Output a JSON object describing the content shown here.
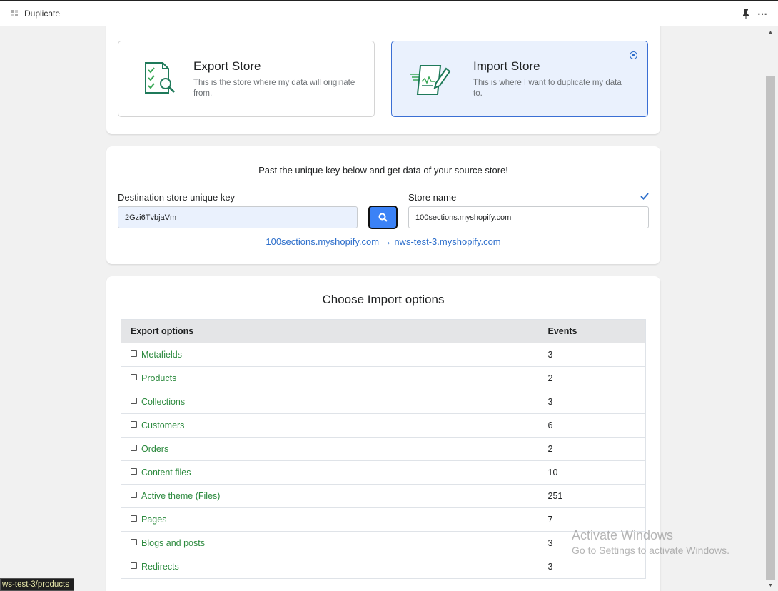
{
  "window": {
    "title": "Duplicate",
    "menu_glyph": "⋯"
  },
  "store_types": {
    "export": {
      "title": "Export Store",
      "description": "This is the store where my data will originate from.",
      "icon": "checklist-search-icon"
    },
    "import": {
      "title": "Import Store",
      "description": "This is where I want to duplicate my data to.",
      "icon": "document-pen-icon",
      "selected": true
    }
  },
  "key_section": {
    "heading": "Past the unique key below and get data of your source store!",
    "key_label": "Destination store unique key",
    "key_value": "2Gzi6TvbjaVm",
    "store_name_label": "Store name",
    "store_name_value": "100sections.myshopify.com",
    "route_from": "100sections.myshopify.com",
    "route_arrow": "→",
    "route_to": "nws-test-3.myshopify.com"
  },
  "import_options": {
    "heading": "Choose Import options",
    "columns": [
      "Export options",
      "Events"
    ],
    "rows": [
      {
        "label": "Metafields",
        "events": "3"
      },
      {
        "label": "Products",
        "events": "2"
      },
      {
        "label": "Collections",
        "events": "3"
      },
      {
        "label": "Customers",
        "events": "6"
      },
      {
        "label": "Orders",
        "events": "2"
      },
      {
        "label": "Content files",
        "events": "10"
      },
      {
        "label": "Active theme (Files)",
        "events": "251"
      },
      {
        "label": "Pages",
        "events": "7"
      },
      {
        "label": "Blogs and posts",
        "events": "3"
      },
      {
        "label": "Redirects",
        "events": "3"
      }
    ]
  },
  "watermark": {
    "line1": "Activate Windows",
    "line2": "Go to Settings to activate Windows."
  },
  "status_url": "ws-test-3/products",
  "colors": {
    "accent": "#2c6ecb",
    "option_green": "#2c8a3e",
    "search_button": "#3b82f6"
  }
}
